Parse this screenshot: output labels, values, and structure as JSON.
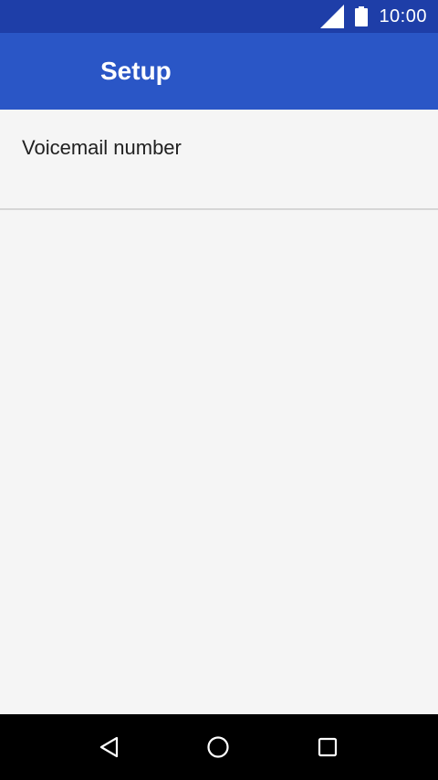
{
  "status_bar": {
    "time": "10:00",
    "signal_icon": "cellular-signal-icon",
    "battery_icon": "battery-full-icon"
  },
  "app_bar": {
    "title": "Setup"
  },
  "preferences": [
    {
      "title": "Voicemail number"
    }
  ],
  "nav_bar": {
    "back_icon": "back-triangle-icon",
    "home_icon": "home-circle-icon",
    "recents_icon": "recents-square-icon"
  },
  "colors": {
    "status_bar": "#1e3ea8",
    "app_bar": "#2a56c6",
    "background": "#f5f5f5",
    "nav_bar": "#000000"
  }
}
